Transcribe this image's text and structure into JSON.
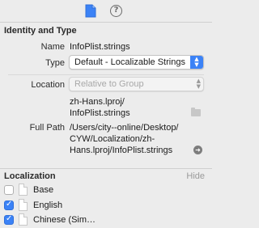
{
  "tabs": {
    "file_inspector_icon": "file-icon",
    "quick_help_icon": "help-icon",
    "quick_help_glyph": "?"
  },
  "identity": {
    "section_title": "Identity and Type",
    "name_label": "Name",
    "name_value": "InfoPlist.strings",
    "type_label": "Type",
    "type_value": "Default - Localizable Strings",
    "location_label": "Location",
    "location_value": "Relative to Group",
    "relative_path_line1": "zh-Hans.lproj/",
    "relative_path_line2": "InfoPlist.strings",
    "full_path_label": "Full Path",
    "full_path_line1": "/Users/city--online/Desktop/",
    "full_path_line2": "CYW/Localization/zh-",
    "full_path_line3": "Hans.lproj/InfoPlist.strings"
  },
  "localization": {
    "section_title": "Localization",
    "hide_label": "Hide",
    "items": [
      {
        "label": "Base",
        "checked": false
      },
      {
        "label": "English",
        "checked": true
      },
      {
        "label": "Chinese (Sim…",
        "checked": true
      }
    ]
  },
  "colors": {
    "accent": "#3b82f6",
    "panel_bg": "#ececec"
  }
}
